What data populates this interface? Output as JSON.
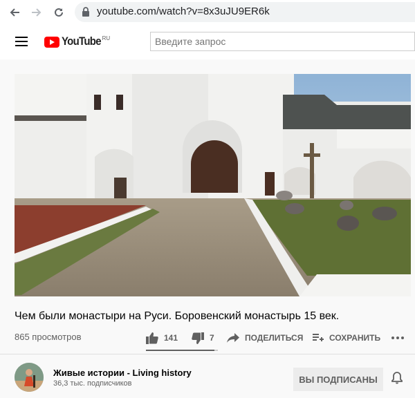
{
  "browser": {
    "url": "youtube.com/watch?v=8x3uJU9ER6k",
    "icons": {
      "back": "arrow-left-icon",
      "forward": "arrow-right-icon",
      "reload": "reload-icon",
      "lock": "lock-icon"
    }
  },
  "header": {
    "logo_text": "YouTube",
    "logo_region": "RU",
    "search_placeholder": "Введите запрос",
    "icons": {
      "menu": "hamburger-menu-icon",
      "logo": "youtube-play-icon"
    }
  },
  "video": {
    "title": "Чем были монастыри на Руси. Боровенский монастырь 15 век.",
    "views": "865 просмотров",
    "likes": "141",
    "dislikes": "7",
    "like_ratio": 0.95,
    "share_label": "ПОДЕЛИТЬСЯ",
    "save_label": "СОХРАНИТЬ",
    "icons": {
      "like": "thumbs-up-icon",
      "dislike": "thumbs-down-icon",
      "share": "share-arrow-icon",
      "save": "playlist-add-icon",
      "more": "more-horiz-icon"
    }
  },
  "channel": {
    "name": "Живые истории - Living history",
    "subscribers": "36,3 тыс. подписчиков",
    "subscribe_label": "ВЫ ПОДПИСАНЫ",
    "icons": {
      "bell": "bell-icon"
    }
  },
  "colors": {
    "brand_red": "#ff0000",
    "text_primary": "#030303",
    "text_secondary": "#606060",
    "page_bg": "#f9f9f9"
  }
}
